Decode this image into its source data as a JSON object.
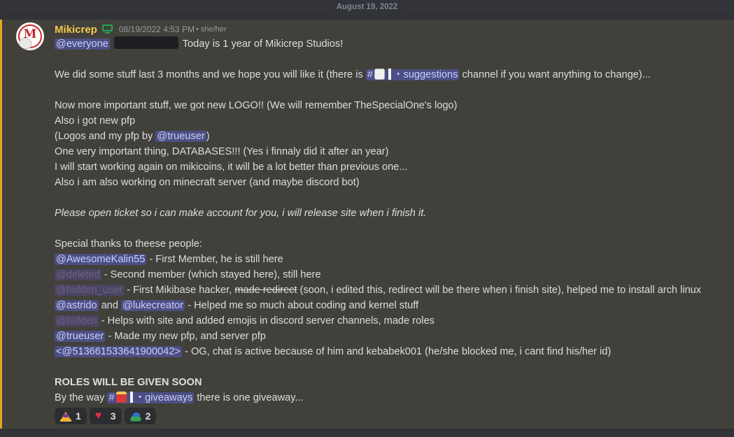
{
  "date_divider": "August 19, 2022",
  "author": {
    "name": "Mikicrep",
    "avatar_letter": "M",
    "timestamp": "08/19/2022 4:53 PM",
    "pronouns": "• she/her"
  },
  "colors": {
    "highlight_border": "#e2a626",
    "message_bg": "#42403a",
    "mention_bg": "#4c4f84",
    "username": "#f2c94c"
  },
  "mentions": {
    "everyone": "@everyone",
    "trueuser": "@trueuser",
    "awesome": "@AwesomeKalin55",
    "astrido": "@astrido",
    "lukecreator": "@lukecreator",
    "raw_id": "<@513661533641900042>"
  },
  "channels": {
    "suggestions": "・suggestions",
    "giveaways": "・giveaways"
  },
  "lines": {
    "l1": "Today is 1 year of Mikicrep Studios!",
    "l2a": "We did some stuff last 3 months and we hope you will like it (there is",
    "l2b": "channel if you want anything to change)...",
    "l3": "Now more important stuff, we got new LOGO!! (We will remember TheSpecialOne's logo)",
    "l4": "Also i got new pfp",
    "l5a": "(Logos and my pfp by",
    "l5b": ")",
    "l6": "One very important thing, DATABASES!!! (Yes i finnaly did it after an year)",
    "l7": "I will start working again on mikicoins, it will be a lot better than previous one...",
    "l8": "Also i am also working on minecraft server (and maybe discord bot)",
    "l9": "Please open ticket so i can make account for you, i will release site when i finish it.",
    "l10": "Special thanks to theese people:",
    "t1": "- First Member, he is still here",
    "t2_mention": "@deleted",
    "t2": "- Second member (which stayed here), still here",
    "t3_mention": "@hidden_user",
    "t3a": "- First Mikibase hacker,",
    "t3_strike": "made redirect",
    "t3b": "(soon, i edited this, redirect will be there when i finish site), helped me to install arch linux",
    "t4_and": "and",
    "t4": "- Helped me so much about coding and kernel stuff",
    "t5_mention": "@hidden",
    "t5": "- Helps with site and added emojis in discord server channels, made roles",
    "t6": "- Made my new pfp, and server pfp",
    "t7": "- OG, chat is active because of him and kebabek001 (he/she blocked me, i cant find his/her id)",
    "roles": "ROLES WILL BE GIVEN SOON",
    "bytheway": "By the way",
    "giveaway_tail": "there is one giveaway..."
  },
  "reactions": [
    {
      "icon": "crown-emoji-icon",
      "count": "1"
    },
    {
      "icon": "heart-emoji-icon",
      "count": "3"
    },
    {
      "icon": "slime-emoji-icon",
      "count": "2"
    }
  ]
}
